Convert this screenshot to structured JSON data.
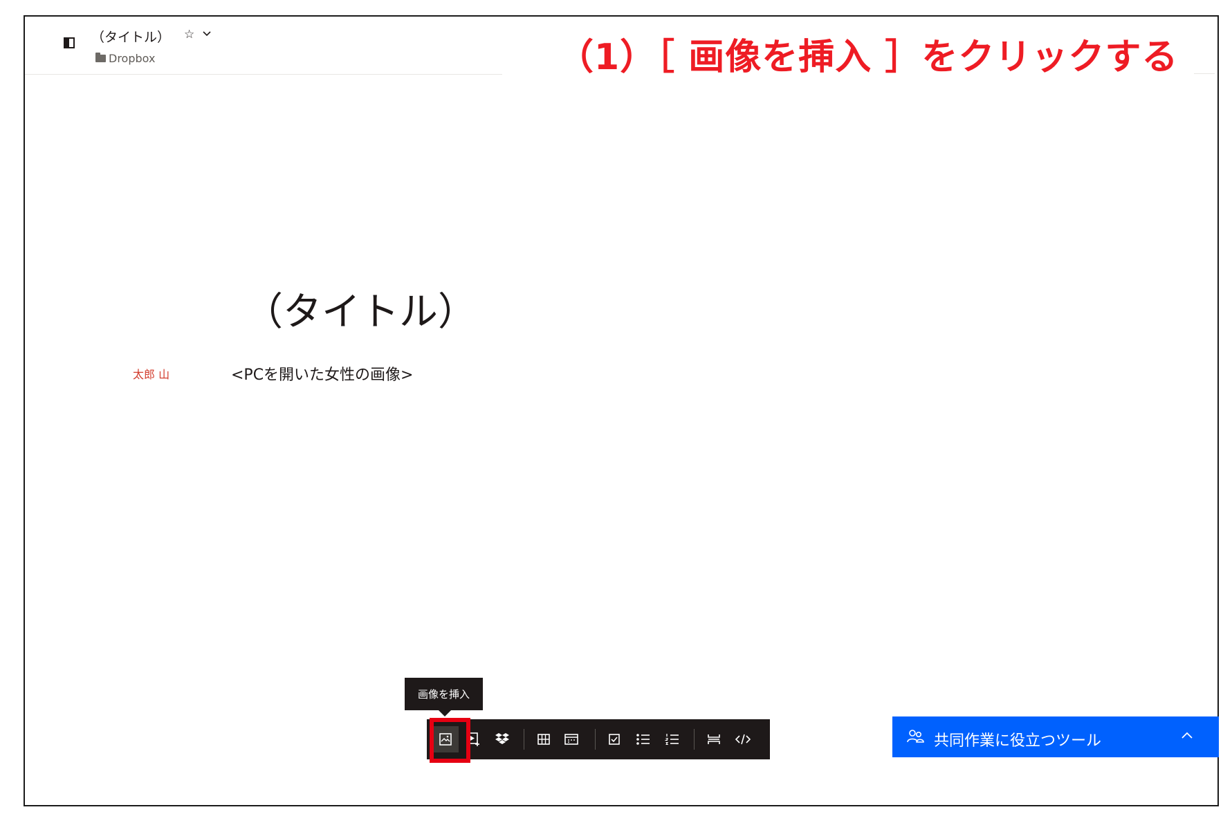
{
  "header": {
    "doc_title": "（タイトル）",
    "folder_name": "Dropbox"
  },
  "annotation": {
    "text": "（1）［ 画像を挿入 ］をクリックする",
    "color": "#ee1c24"
  },
  "document": {
    "title": "（タイトル）",
    "author": "太郎 山",
    "body_line": "<PCを開いた女性の画像>"
  },
  "tooltip": {
    "text": "画像を挿入"
  },
  "toolbar": {
    "buttons": [
      {
        "icon": "insert-image-icon",
        "active": true
      },
      {
        "icon": "insert-video-icon"
      },
      {
        "icon": "dropbox-icon"
      },
      {
        "icon": "table-icon"
      },
      {
        "icon": "timeline-icon"
      },
      {
        "icon": "checkbox-icon"
      },
      {
        "icon": "bullet-list-icon"
      },
      {
        "icon": "numbered-list-icon"
      },
      {
        "icon": "divider-icon"
      },
      {
        "icon": "code-icon"
      }
    ]
  },
  "collab": {
    "label": "共同作業に役立つツール",
    "color": "#0061fe"
  },
  "colors": {
    "highlight": "#e60012",
    "toolbar_bg": "#1e1919"
  }
}
